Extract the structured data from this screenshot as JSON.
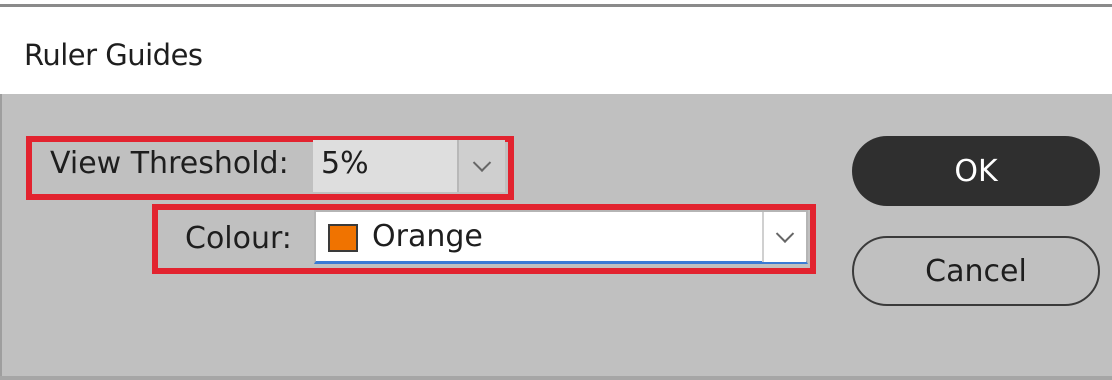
{
  "dialog": {
    "title": "Ruler Guides"
  },
  "view_threshold": {
    "label": "View Threshold:",
    "value": "5%",
    "dropdown_icon": "chevron-down-icon"
  },
  "colour": {
    "label": "Colour:",
    "value": "Orange",
    "swatch_color": "#f07300",
    "dropdown_icon": "chevron-down-icon"
  },
  "buttons": {
    "ok_label": "OK",
    "cancel_label": "Cancel"
  },
  "colors": {
    "highlight": "#e2232f",
    "panel_bg": "#c0c0c0",
    "ok_bg": "#2f2f2f",
    "focus_underline": "#3a7bd5"
  }
}
